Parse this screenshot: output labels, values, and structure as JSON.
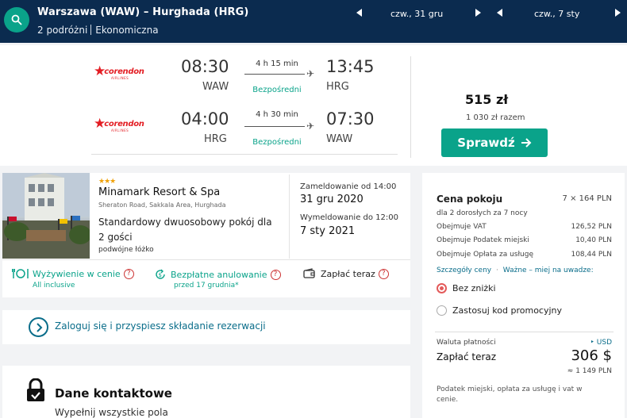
{
  "header": {
    "route": "Warszawa (WAW) – Hurghada (HRG)",
    "travellers": "2 podróżni",
    "cabin": "Ekonomiczna",
    "depart_date": "czw., 31 gru",
    "return_date": "czw., 7 sty"
  },
  "flight": {
    "outbound": {
      "airline": "corendon",
      "airline_sub": "AIRLINES",
      "dep_time": "08:30",
      "dep_code": "WAW",
      "duration": "4 h 15 min",
      "stops": "Bezpośredni",
      "arr_time": "13:45",
      "arr_code": "HRG"
    },
    "inbound": {
      "airline": "corendon",
      "airline_sub": "AIRLINES",
      "dep_time": "04:00",
      "dep_code": "HRG",
      "duration": "4 h 30 min",
      "stops": "Bezpośredni",
      "arr_time": "07:30",
      "arr_code": "WAW"
    },
    "price": "515 zł",
    "total": "1 030 zł razem",
    "cta": "Sprawdź"
  },
  "hotel": {
    "stars": "★★★",
    "name": "Minamark Resort & Spa",
    "address": "Sheraton Road, Sakkala Area, Hurghada",
    "room": "Standardowy dwuosobowy pokój dla 2 gości",
    "bed": "podwójne łóżko",
    "checkin_label": "Zameldowanie od 14:00",
    "checkin_date": "31 gru 2020",
    "checkout_label": "Wymeldowanie do 12:00",
    "checkout_date": "7 sty 2021",
    "features": {
      "meal": "Wyżywienie w cenie",
      "meal_sub": "All inclusive",
      "cancel": "Bezpłatne anulowanie",
      "cancel_sub": "przed 17 grudnia*",
      "pay_now": "Zapłać teraz",
      "help_mark": "?"
    }
  },
  "login": {
    "text": "Zaloguj się i przyspiesz składanie rezerwacji"
  },
  "contact": {
    "title": "Dane kontaktowe",
    "subtitle": "Wypełnij wszystkie pola"
  },
  "pricing": {
    "room_price_label": "Cena pokoju",
    "room_price_value": "7 × 164 PLN",
    "guests": "dla 2 dorosłych  za 7 nocy",
    "lines": [
      {
        "label": "Obejmuje VAT",
        "value": "126,52 PLN"
      },
      {
        "label": "Obejmuje Podatek miejski",
        "value": "10,40 PLN"
      },
      {
        "label": "Obejmuje Opłata za usługę",
        "value": "108,44 PLN"
      }
    ],
    "details_link": "Szczegóły ceny",
    "note_link": "Ważne – miej na uwadze:",
    "link_sep": "·",
    "option_no_discount": "Bez zniżki",
    "option_promo": "Zastosuj kod promocyjny",
    "currency_label": "Waluta płatności",
    "currency_value": "‣ USD",
    "pay_now_label": "Zapłać teraz",
    "pay_now_value": "306 $",
    "pay_now_pln": "≈ 1 149 PLN",
    "tax_note": "Podatek miejski, opłata za usługę i vat w cenie."
  },
  "colors": {
    "header_bg": "#0b2b4f",
    "accent": "#0aa38a",
    "brand_red": "#e31e24",
    "link": "#0a6d8a"
  }
}
